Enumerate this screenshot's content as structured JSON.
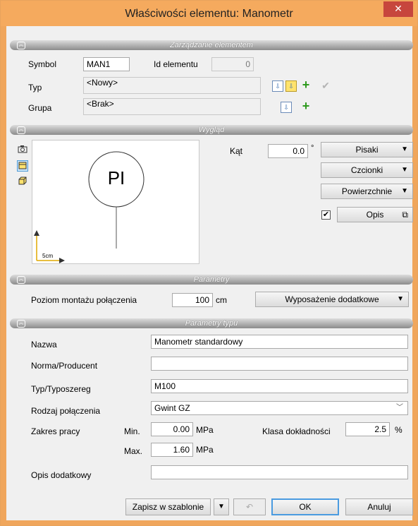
{
  "window": {
    "title": "Właściwości elementu: Manometr",
    "close_glyph": "✕"
  },
  "sections": {
    "management": "Zarządzanie elementem",
    "appearance": "Wygląd",
    "params": "Parametry",
    "type_params": "Parametry typu"
  },
  "management": {
    "symbol_label": "Symbol",
    "symbol_value": "MAN1",
    "id_label": "Id elementu",
    "id_value": "0",
    "type_label": "Typ",
    "type_value": "<Nowy>",
    "group_label": "Grupa",
    "group_value": "<Brak>"
  },
  "appearance": {
    "angle_label": "Kąt",
    "angle_value": "0.0",
    "angle_unit": "°",
    "pens_button": "Pisaki",
    "fonts_button": "Czcionki",
    "surfaces_button": "Powierzchnie",
    "desc_checked": true,
    "desc_button": "Opis",
    "preview_symbol": "PI",
    "preview_scale": "5cm"
  },
  "params": {
    "mount_label": "Poziom montażu połączenia",
    "mount_value": "100",
    "mount_unit": "cm",
    "extra_button": "Wyposażenie dodatkowe"
  },
  "type_params": {
    "name_label": "Nazwa",
    "name_value": "Manometr standardowy",
    "norm_label": "Norma/Producent",
    "norm_value": "",
    "series_label": "Typ/Typoszereg",
    "series_value": "M100",
    "conn_label": "Rodzaj połączenia",
    "conn_value": "Gwint GZ",
    "range_label": "Zakres pracy",
    "min_label": "Min.",
    "min_value": "0.00",
    "max_label": "Max.",
    "max_value": "1.60",
    "pressure_unit": "MPa",
    "class_label": "Klasa dokładności",
    "class_value": "2.5",
    "class_unit": "%",
    "desc_label": "Opis dodatkowy",
    "desc_value": ""
  },
  "footer": {
    "save_template": "Zapisz w szablonie",
    "ok": "OK",
    "cancel": "Anuluj"
  },
  "colors": {
    "titlebar": "#f5aa5e",
    "close": "#c7463d",
    "plus": "#2e9a1e"
  }
}
